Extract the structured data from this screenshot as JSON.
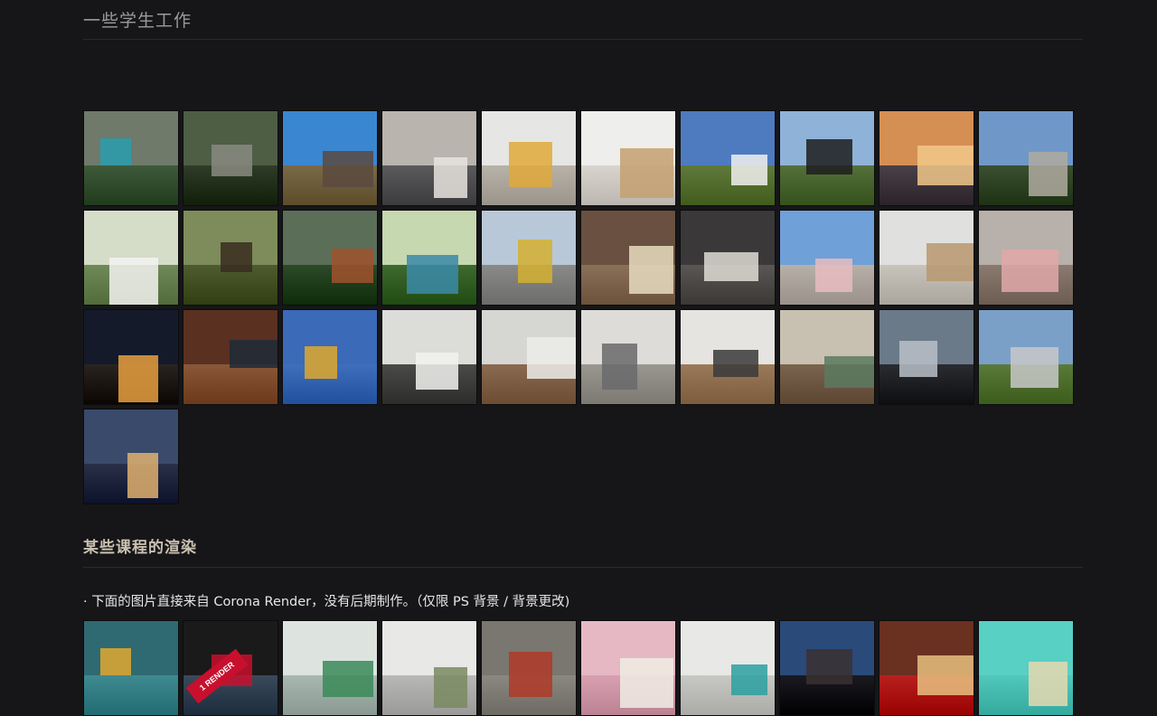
{
  "section1": {
    "title": "一些学生工作",
    "thumbnails": [
      {
        "name": "villa-pool-render",
        "sky": "#6f7a6a",
        "ground": "#3e5a3a",
        "accent": "#2a9dae"
      },
      {
        "name": "forest-house-render",
        "sky": "#4d5e45",
        "ground": "#2f3d28",
        "accent": "#8a8a80"
      },
      {
        "name": "cabin-field-render",
        "sky": "#3b86d0",
        "ground": "#7a6a48",
        "accent": "#5a4a40"
      },
      {
        "name": "bedroom-sofa-render",
        "sky": "#b9b4ad",
        "ground": "#5a5a5c",
        "accent": "#e8e4df"
      },
      {
        "name": "living-room-render",
        "sky": "#e6e6e4",
        "ground": "#b8b2a8",
        "accent": "#e0a93a"
      },
      {
        "name": "lounge-chair-render",
        "sky": "#eeeeec",
        "ground": "#d9d5ce",
        "accent": "#c4a070"
      },
      {
        "name": "curved-building-render",
        "sky": "#4e7bbf",
        "ground": "#5f7a3a",
        "accent": "#f1f1ef"
      },
      {
        "name": "dark-barn-render",
        "sky": "#8fb2d8",
        "ground": "#54703a",
        "accent": "#1d1d1f"
      },
      {
        "name": "city-sunset-render",
        "sky": "#d68f52",
        "ground": "#4a4048",
        "accent": "#f1c889"
      },
      {
        "name": "modern-house-render",
        "sky": "#6f98c8",
        "ground": "#3a5030",
        "accent": "#b0aaa0"
      },
      {
        "name": "white-terrace-render",
        "sky": "#d5dcc8",
        "ground": "#6f8a58",
        "accent": "#f3f3f1"
      },
      {
        "name": "woodland-render",
        "sky": "#7d8c5a",
        "ground": "#4e5c30",
        "accent": "#3a2c20"
      },
      {
        "name": "garden-path-render",
        "sky": "#5a6e58",
        "ground": "#2c4a28",
        "accent": "#a0522d"
      },
      {
        "name": "courtyard-pool-render",
        "sky": "#c5d8b0",
        "ground": "#3e6a30",
        "accent": "#3a8aa8"
      },
      {
        "name": "housing-block-render",
        "sky": "#b8c8d8",
        "ground": "#8a8a88",
        "accent": "#d4b030"
      },
      {
        "name": "rustic-interior-render",
        "sky": "#6a5040",
        "ground": "#8a7058",
        "accent": "#e8dcc0"
      },
      {
        "name": "dark-bedroom-render",
        "sky": "#3a3838",
        "ground": "#5a5654",
        "accent": "#dedad4"
      },
      {
        "name": "pink-facade-render",
        "sky": "#6fa0d8",
        "ground": "#b8b0a8",
        "accent": "#e8bcc0"
      },
      {
        "name": "white-stair-render",
        "sky": "#e0e0de",
        "ground": "#c8c4bc",
        "accent": "#b89870"
      },
      {
        "name": "pink-sofa-render",
        "sky": "#b8b0aa",
        "ground": "#8a7a70",
        "accent": "#e0a8a8"
      },
      {
        "name": "night-sky-render",
        "sky": "#141a2a",
        "ground": "#2a2420",
        "accent": "#e8a040"
      },
      {
        "name": "slat-wall-render",
        "sky": "#5a3020",
        "ground": "#8a5838",
        "accent": "#1e2a38"
      },
      {
        "name": "yellow-chair-render",
        "sky": "#3a6ab8",
        "ground": "#3f6fbc",
        "accent": "#e0a82a"
      },
      {
        "name": "kitchen-grey-render",
        "sky": "#dcdcd8",
        "ground": "#4a4a48",
        "accent": "#f2f2f0"
      },
      {
        "name": "hallway-render",
        "sky": "#d6d6d2",
        "ground": "#8a6a50",
        "accent": "#ececea"
      },
      {
        "name": "grey-sofa-render",
        "sky": "#dedcd8",
        "ground": "#9a9690",
        "accent": "#6a6a6c"
      },
      {
        "name": "dining-kitchen-render",
        "sky": "#e6e4e0",
        "ground": "#9a7a5a",
        "accent": "#3a3a3a"
      },
      {
        "name": "green-kitchen-render",
        "sky": "#c8c0b0",
        "ground": "#7a6450",
        "accent": "#5a7a60"
      },
      {
        "name": "car-render",
        "sky": "#6a7a88",
        "ground": "#2a2c30",
        "accent": "#b8c0c8"
      },
      {
        "name": "aerial-field-render",
        "sky": "#7aa0c8",
        "ground": "#5a7a3a",
        "accent": "#c8c8c8"
      },
      {
        "name": "tower-night-render",
        "sky": "#3a4a6a",
        "ground": "#2a3048",
        "accent": "#e0b070"
      }
    ]
  },
  "section2": {
    "title": "某些课程的渲染",
    "note": "· 下面的图片直接来自 Corona Render，没有后期制作。（仅限 PS 背景 / 背景更改)",
    "badge_text": "1 RENDER",
    "thumbnails": [
      {
        "name": "teal-bedroom-render",
        "sky": "#2f6a72",
        "ground": "#3f8a90",
        "accent": "#e0a830"
      },
      {
        "name": "comparison-render",
        "sky": "#1a1a1a",
        "ground": "#3a4a5a",
        "accent": "#c8102e"
      },
      {
        "name": "glassware-render",
        "sky": "#dde4e0",
        "ground": "#a8b8b0",
        "accent": "#3a8a58"
      },
      {
        "name": "dish-rack-render",
        "sky": "#e8e8e6",
        "ground": "#b8b8b6",
        "accent": "#7a8a60"
      },
      {
        "name": "car-motion-render",
        "sky": "#7a7670",
        "ground": "#8a8880",
        "accent": "#b03a28"
      },
      {
        "name": "retro-tv-render",
        "sky": "#e6b8c4",
        "ground": "#d8a0b0",
        "accent": "#f0ece4"
      },
      {
        "name": "bathroom-render",
        "sky": "#e8e8e6",
        "ground": "#c8c8c4",
        "accent": "#2aa0a0"
      },
      {
        "name": "cinema-seat-render",
        "sky": "#2a4a7a",
        "ground": "#1a1a20",
        "accent": "#3a3030"
      },
      {
        "name": "theater-render",
        "sky": "#6a3020",
        "ground": "#b82020",
        "accent": "#e8c080"
      },
      {
        "name": "wishbone-chair-render",
        "sky": "#58d0c4",
        "ground": "#52c8bc",
        "accent": "#e8d8b0"
      }
    ]
  }
}
